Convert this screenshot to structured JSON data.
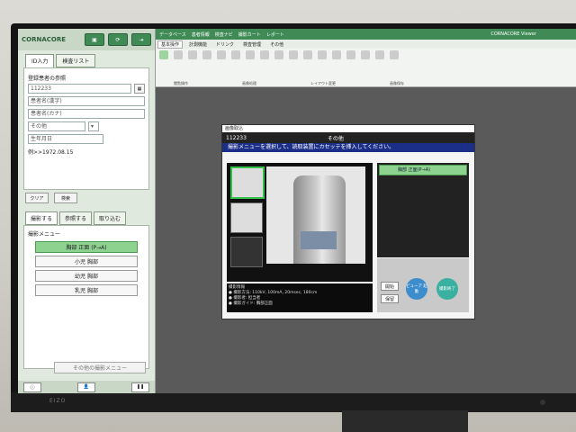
{
  "left": {
    "logo": "CORNACORE",
    "tabs": [
      "ID入力",
      "検査リスト"
    ],
    "form": {
      "title": "登録患者の参照",
      "id_value": "112233",
      "name_kanji_placeholder": "患者名(漢字)",
      "name_kana_placeholder": "患者名(カナ)",
      "other_label": "その他",
      "dob_placeholder": "生年月日",
      "dob_example": "例>>1972.08.15"
    },
    "form_buttons": [
      "クリア",
      "検索"
    ],
    "exam_tabs": [
      "撮影する",
      "参照する",
      "取り込む"
    ],
    "menu_title": "撮影メニュー",
    "menu_items": [
      "胸部 正面 (P→A)",
      "小児 胸部",
      "幼児 胸部",
      "乳児 胸部"
    ],
    "other_menu": "その他の撮影メニュー"
  },
  "viewer": {
    "top_links": [
      "データベース",
      "患者情報",
      "検査ナビ",
      "撮影カート",
      "レポート"
    ],
    "title": "CORNACORE Viewer",
    "tabs": [
      "基本操作",
      "計測機能",
      "ドリンク",
      "検査管理",
      "その他"
    ],
    "group_labels": [
      "閲覧操作",
      "画像処理",
      "レイアウト変更",
      "画像保存"
    ]
  },
  "dialog": {
    "window_title": "画像取込",
    "patient_id": "112233",
    "section": "その他",
    "message": "撮影メニューを選択して、読取装置にカセッテを挿入してください。",
    "queue_item": "胸部 正面(P→A)",
    "info_lines": [
      "撮影情報",
      "● 撮影方法: 110kV, 100mA, 20msec, 180cm",
      "● 撮影者: 担当者",
      "● 撮影ガイド: 胸部正面"
    ],
    "buttons": {
      "open": "開始",
      "save": "保留",
      "blue": "ビューア 起動",
      "teal": "撮影終了"
    }
  }
}
